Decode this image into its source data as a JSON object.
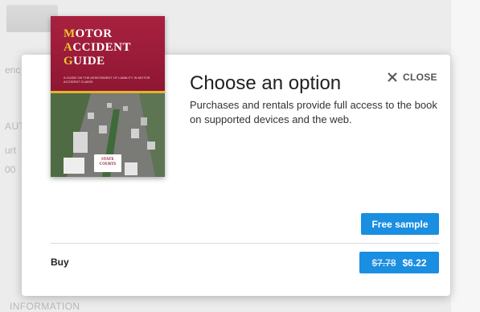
{
  "background": {
    "text_1": "enc",
    "text_2": "AUT",
    "text_3": "urt",
    "text_4": "00",
    "text_5": "INFORMATION"
  },
  "book": {
    "title_lines": [
      {
        "initial": "M",
        "rest": "OTOR"
      },
      {
        "initial": "A",
        "rest": "CCIDENT"
      },
      {
        "initial": "G",
        "rest": "UIDE"
      }
    ],
    "subtitle": "A GUIDE ON THE ASSESSMENT OF LIABILITY IN MOTOR ACCIDENT CLAIMS",
    "publisher": "STATE COURTS"
  },
  "dialog": {
    "title": "Choose an option",
    "description": "Purchases and rentals provide full access to the book on supported devices and the web.",
    "close_label": "CLOSE",
    "close_icon": "close-icon",
    "free_sample_label": "Free sample",
    "buy_label": "Buy",
    "original_price": "$7.78",
    "sale_price": "$6.22"
  },
  "colors": {
    "accent": "#1a8ee1",
    "cover_red": "#9d1b3a",
    "cover_gold": "#e3b42c"
  }
}
